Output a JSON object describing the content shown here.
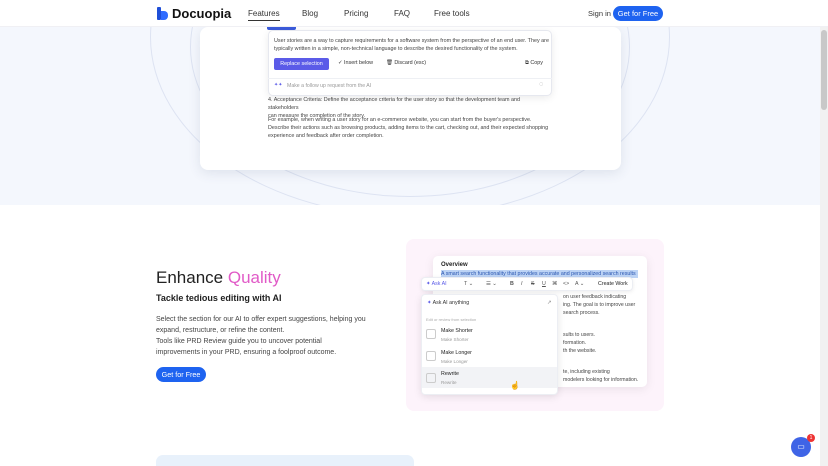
{
  "nav": {
    "logo": "Docuopia",
    "links": [
      "Features",
      "Blog",
      "Pricing",
      "FAQ",
      "Free tools"
    ],
    "signin": "Sign in",
    "cta": "Get for Free"
  },
  "editor": {
    "popup_text": "User stories are a way to capture requirements for a software system from the perspective of an end user. They are typically written in a simple, non-technical language to describe the desired functionality of the system.",
    "replace": "Replace selection",
    "insert": "Insert below",
    "discard": "Discard",
    "discard_key": "(esc)",
    "copy": "Copy",
    "followup_placeholder": "Make a follow up request from the AI",
    "criteria_line1": "4. Acceptance Criteria: Define the acceptance criteria for the user story so that the development team and stakeholders",
    "criteria_line2": "can measure the completion of the story.",
    "example": "For example, when writing a user story for an e-commerce website, you can start from the buyer's perspective. Describe their actions such as browsing products, adding items to the cart, checking out, and their expected shopping experience and feedback after order completion."
  },
  "section": {
    "title_prefix": "Enhance ",
    "title_accent": "Quality",
    "subtitle": "Tackle tedious editing with AI",
    "desc1": "Select the section for our AI to offer expert suggestions, helping you expand, restructure, or refine the content.",
    "desc2": "Tools like PRD Review guide you to uncover potential improvements in your PRD, ensuring a foolproof outcome.",
    "cta": "Get for Free"
  },
  "demo": {
    "overview_title": "Overview",
    "highlight": "A smart search functionality that provides accurate and personalized search results",
    "lines": [
      "on user feedback indicating",
      "ing. The goal is to improve user",
      "search process.",
      "sults to users.",
      "formation.",
      "th the website.",
      "te, including existing",
      "modelers looking for information."
    ],
    "toolbar": {
      "ask_ai": "Ask AI",
      "create_work": "Create Work"
    },
    "ask_placeholder": "Ask AI anything",
    "menu_hint": "Edit or review from selection",
    "items": [
      {
        "title": "Make Shorter",
        "sub": "Make Shorter"
      },
      {
        "title": "Make Longer",
        "sub": "Make Longer"
      },
      {
        "title": "Rewrite",
        "sub": "Rewrite"
      }
    ]
  },
  "chat": {
    "badge": "1"
  }
}
